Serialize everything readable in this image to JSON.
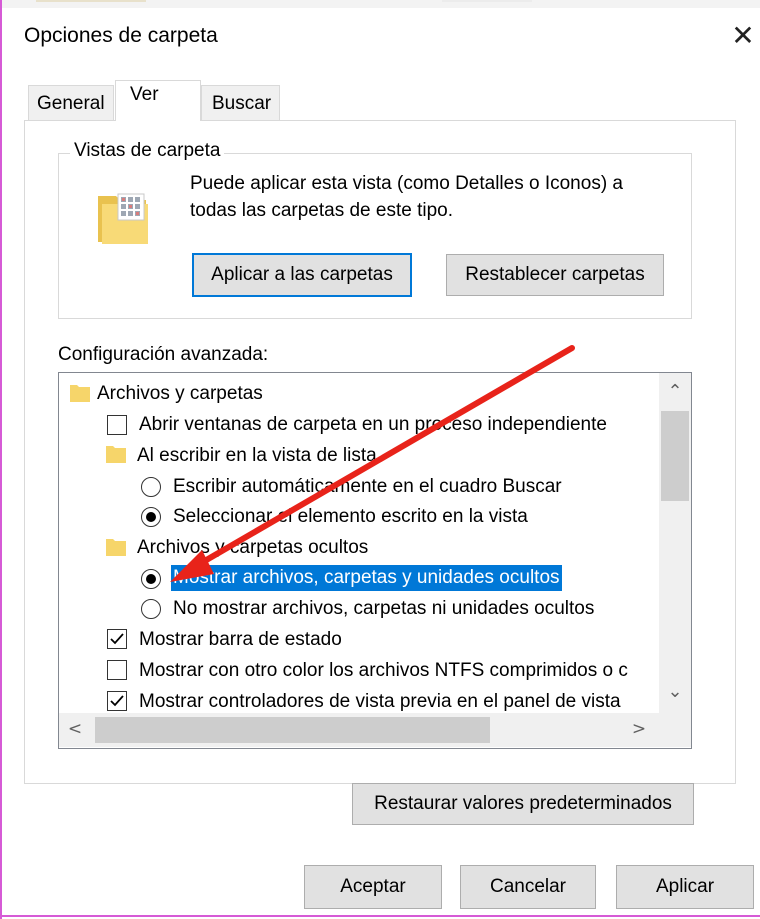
{
  "window": {
    "title": "Opciones de carpeta",
    "close_glyph": "✕"
  },
  "tabs": [
    {
      "label": "General",
      "active": false
    },
    {
      "label": "Ver",
      "active": true
    },
    {
      "label": "Buscar",
      "active": false
    }
  ],
  "folder_views": {
    "legend": "Vistas de carpeta",
    "description": "Puede aplicar esta vista (como Detalles o Iconos) a todas las carpetas de este tipo.",
    "apply_button": "Aplicar a las carpetas",
    "reset_button": "Restablecer carpetas",
    "icon": "folder-grid-icon"
  },
  "advanced": {
    "label": "Configuración avanzada:",
    "items": [
      {
        "type": "folder",
        "label": "Archivos y carpetas"
      },
      {
        "type": "checkbox",
        "label": "Abrir ventanas de carpeta  en un proceso independiente",
        "checked": false
      },
      {
        "type": "folder",
        "label": "Al escribir en la vista de lista"
      },
      {
        "type": "radio",
        "label": "Escribir automáticamente en el cuadro Buscar",
        "checked": false
      },
      {
        "type": "radio",
        "label": "Seleccionar el elemento escrito en la vista",
        "checked": true
      },
      {
        "type": "folder",
        "label": "Archivos y carpetas ocultos"
      },
      {
        "type": "radio",
        "label": "Mostrar archivos, carpetas y unidades ocultos",
        "checked": true,
        "selected": true
      },
      {
        "type": "radio",
        "label": "No mostrar archivos, carpetas ni unidades ocultos",
        "checked": false
      },
      {
        "type": "checkbox",
        "label": "Mostrar barra de estado",
        "checked": true
      },
      {
        "type": "checkbox",
        "label": "Mostrar con otro color los archivos NTFS comprimidos o c",
        "checked": false
      },
      {
        "type": "checkbox",
        "label": "Mostrar controladores de vista previa en el panel de vista",
        "checked": true
      }
    ],
    "scroll_up": "⌃",
    "scroll_down": "⌄",
    "scroll_left": "<",
    "scroll_right": ">"
  },
  "restore_button": "Restaurar valores predeterminados",
  "footer": {
    "ok": "Aceptar",
    "cancel": "Cancelar",
    "apply": "Aplicar"
  },
  "colors": {
    "selection": "#0078d7",
    "annotation_arrow": "#e8231a",
    "folder": "#f6d56a"
  }
}
